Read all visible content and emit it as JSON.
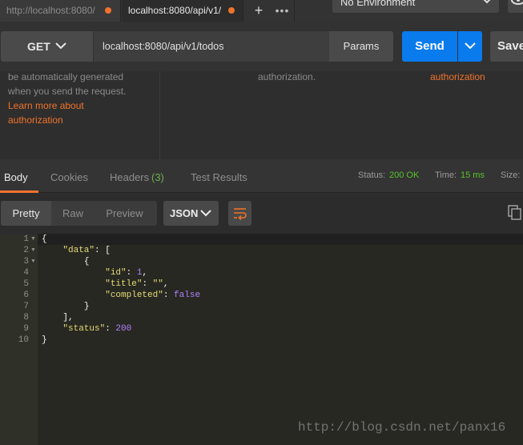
{
  "tabs": [
    {
      "title": "http://localhost:8080/",
      "dot_color": "#f0732c"
    },
    {
      "title": "localhost:8080/api/v1/",
      "dot_color": "#f0732c"
    }
  ],
  "tab_add_label": "+",
  "tab_more_label": "•••",
  "environment": {
    "selected": "No Environment"
  },
  "request": {
    "method": "GET",
    "url": "localhost:8080/api/v1/todos",
    "params_label": "Params",
    "send_label": "Send",
    "save_label": "Save"
  },
  "auth_info": {
    "line1": "be automatically generated",
    "line2": "when you send the request.",
    "link_line1": "Learn more about",
    "link_line2": "authorization",
    "middle_text": "authorization.",
    "right_link": "authorization"
  },
  "response_tabs": {
    "body": "Body",
    "cookies": "Cookies",
    "headers": "Headers",
    "headers_count": "(3)",
    "test_results": "Test Results"
  },
  "response_meta": {
    "status_label": "Status:",
    "status_value": "200 OK",
    "time_label": "Time:",
    "time_value": "15 ms",
    "size_label": "Size:"
  },
  "format": {
    "pretty": "Pretty",
    "raw": "Raw",
    "preview": "Preview",
    "language": "JSON"
  },
  "code_lines": [
    {
      "n": "1",
      "fold": true
    },
    {
      "n": "2",
      "fold": true
    },
    {
      "n": "3",
      "fold": true
    },
    {
      "n": "4",
      "fold": false
    },
    {
      "n": "5",
      "fold": false
    },
    {
      "n": "6",
      "fold": false
    },
    {
      "n": "7",
      "fold": false
    },
    {
      "n": "8",
      "fold": false
    },
    {
      "n": "9",
      "fold": false
    },
    {
      "n": "10",
      "fold": false
    }
  ],
  "code": {
    "l1": "{",
    "l2_key": "\"data\"",
    "l2_rest": ": [",
    "l3": "{",
    "l4_key": "\"id\"",
    "l4_sep": ": ",
    "l4_val": "1",
    "l4_end": ",",
    "l5_key": "\"title\"",
    "l5_sep": ": ",
    "l5_val": "\"\"",
    "l5_end": ",",
    "l6_key": "\"completed\"",
    "l6_sep": ": ",
    "l6_val": "false",
    "l7": "}",
    "l8": "],",
    "l9_key": "\"status\"",
    "l9_sep": ": ",
    "l9_val": "200",
    "l10": "}"
  },
  "watermark": "http://blog.csdn.net/panx16"
}
